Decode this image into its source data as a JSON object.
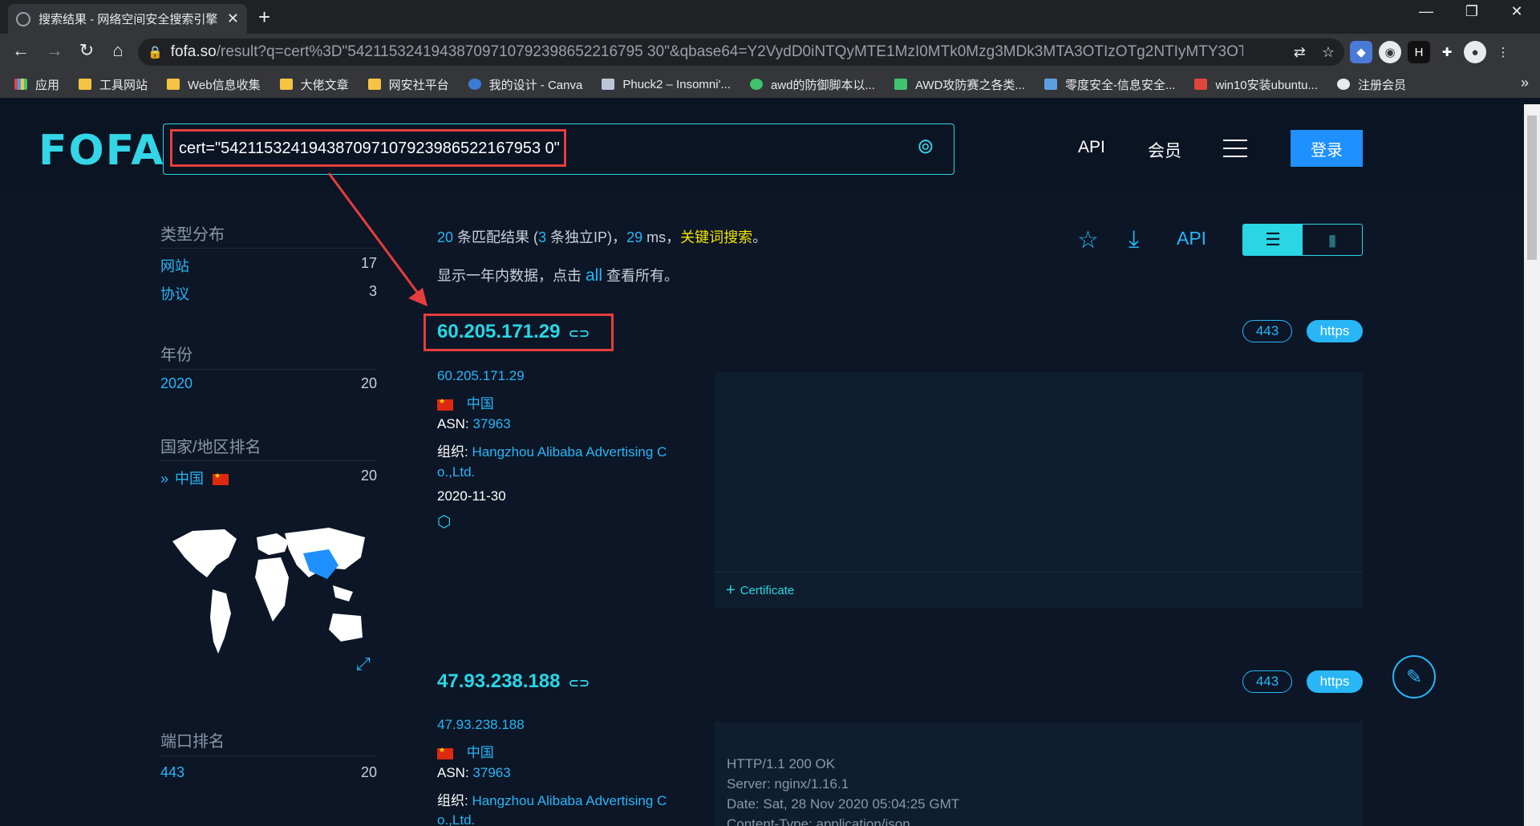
{
  "browser": {
    "tab_title": "搜索结果 - 网络空间安全搜索引擎",
    "url_host": "fofa.so",
    "url_rest": "/result?q=cert%3D\"54211532419438709710792398652216795 30\"&qbase64=Y2VydD0iNTQyMTE1MzI0MTk0Mzg3MDk3MTA3OTIzOTg2NTIyMTY3OTUz...",
    "bookmarks": [
      "应用",
      "工具网站",
      "Web信息收集",
      "大佬文章",
      "网安社平台",
      "我的设计 - Canva",
      "Phuck2 – Insomni'...",
      "awd的防御脚本以...",
      "AWD攻防赛之各类...",
      "零度安全-信息安全...",
      "win10安装ubuntu...",
      "注册会员"
    ]
  },
  "header": {
    "logo": "FOFA",
    "query": "cert=\"542115324194387097107923986522167953 0\"",
    "nav_api": "API",
    "nav_member": "会员",
    "login": "登录"
  },
  "sidebar": {
    "type_title": "类型分布",
    "types": [
      {
        "label": "网站",
        "count": "17"
      },
      {
        "label": "协议",
        "count": "3"
      }
    ],
    "year_title": "年份",
    "years": [
      {
        "label": "2020",
        "count": "20"
      }
    ],
    "country_title": "国家/地区排名",
    "countries": [
      {
        "label": "中国",
        "count": "20"
      }
    ],
    "port_title": "端口排名",
    "ports": [
      {
        "label": "443",
        "count": "20"
      }
    ]
  },
  "summary": {
    "count": "20",
    "t1": " 条匹配结果 (",
    "ips": "3",
    "t2": " 条独立IP)，",
    "ms": "29",
    "t3": " ms，",
    "keyword": "关键词搜索",
    "t4": "。",
    "line2_a": "显示一年内数据，点击 ",
    "line2_all": "all",
    "line2_b": " 查看所有。",
    "api": "API"
  },
  "results": [
    {
      "ip": "60.205.171.29",
      "port": "443",
      "protocol": "https",
      "ip_small": "60.205.171.29",
      "country": "中国",
      "asn_label": "ASN: ",
      "asn": "37963",
      "org_label": "组织: ",
      "org_1": "Hangzhou Alibaba Advertising C",
      "org_2": "o.,Ltd.",
      "date": "2020-11-30",
      "cert_toggle": "Certificate"
    },
    {
      "ip": "47.93.238.188",
      "port": "443",
      "protocol": "https",
      "ip_small": "47.93.238.188",
      "country": "中国",
      "asn_label": "ASN: ",
      "asn": "37963",
      "org_label": "组织: ",
      "org_1": "Hangzhou Alibaba Advertising C",
      "org_2": "o.,Ltd.",
      "http": [
        "HTTP/1.1 200 OK",
        "Server: nginx/1.16.1",
        "Date: Sat, 28 Nov 2020 05:04:25 GMT",
        "Content-Type: application/json"
      ]
    }
  ]
}
